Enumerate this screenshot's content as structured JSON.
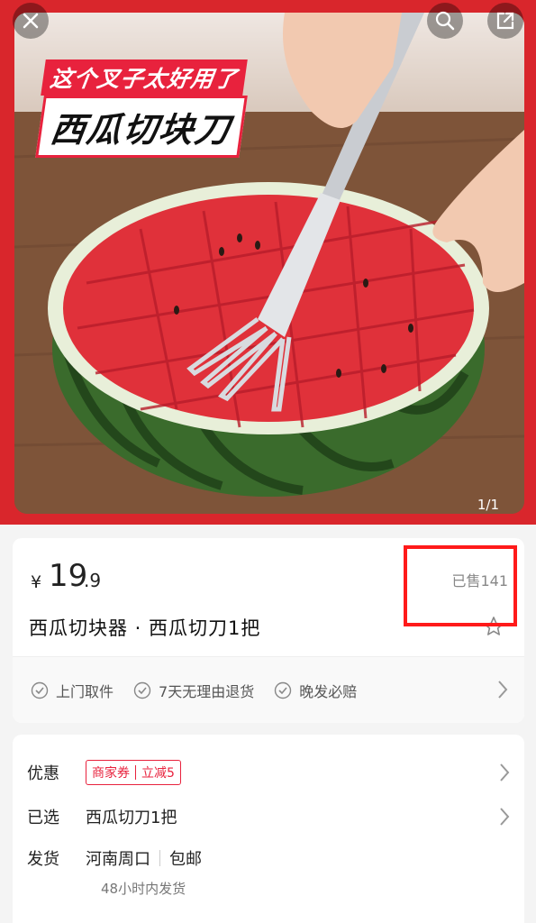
{
  "hero": {
    "headline_line1": "这个叉子太好用了",
    "headline_line2": "西瓜切块刀",
    "image_counter": "1/1",
    "icons": [
      "close-icon",
      "search-icon",
      "share-icon"
    ]
  },
  "product": {
    "currency": "¥",
    "price_int": "19",
    "price_dec": ".9",
    "sold": "已售141",
    "title": "西瓜切块器 · 西瓜切刀1把"
  },
  "services": [
    {
      "label": "上门取件",
      "icon": "check-circle-icon"
    },
    {
      "label": "7天无理由退货",
      "icon": "check-circle-icon"
    },
    {
      "label": "晚发必赔",
      "icon": "check-circle-icon"
    }
  ],
  "details": {
    "promo_label": "优惠",
    "coupon_left": "商家券",
    "coupon_right": "立减5",
    "selected_label": "已选",
    "selected_value": "西瓜切刀1把",
    "ship_label": "发货",
    "ship_from": "河南周口",
    "ship_free": "包邮",
    "ship_time": "48小时内发货"
  },
  "colors": {
    "accent": "#e8223d",
    "highlight_box": "#ff1a1a"
  }
}
